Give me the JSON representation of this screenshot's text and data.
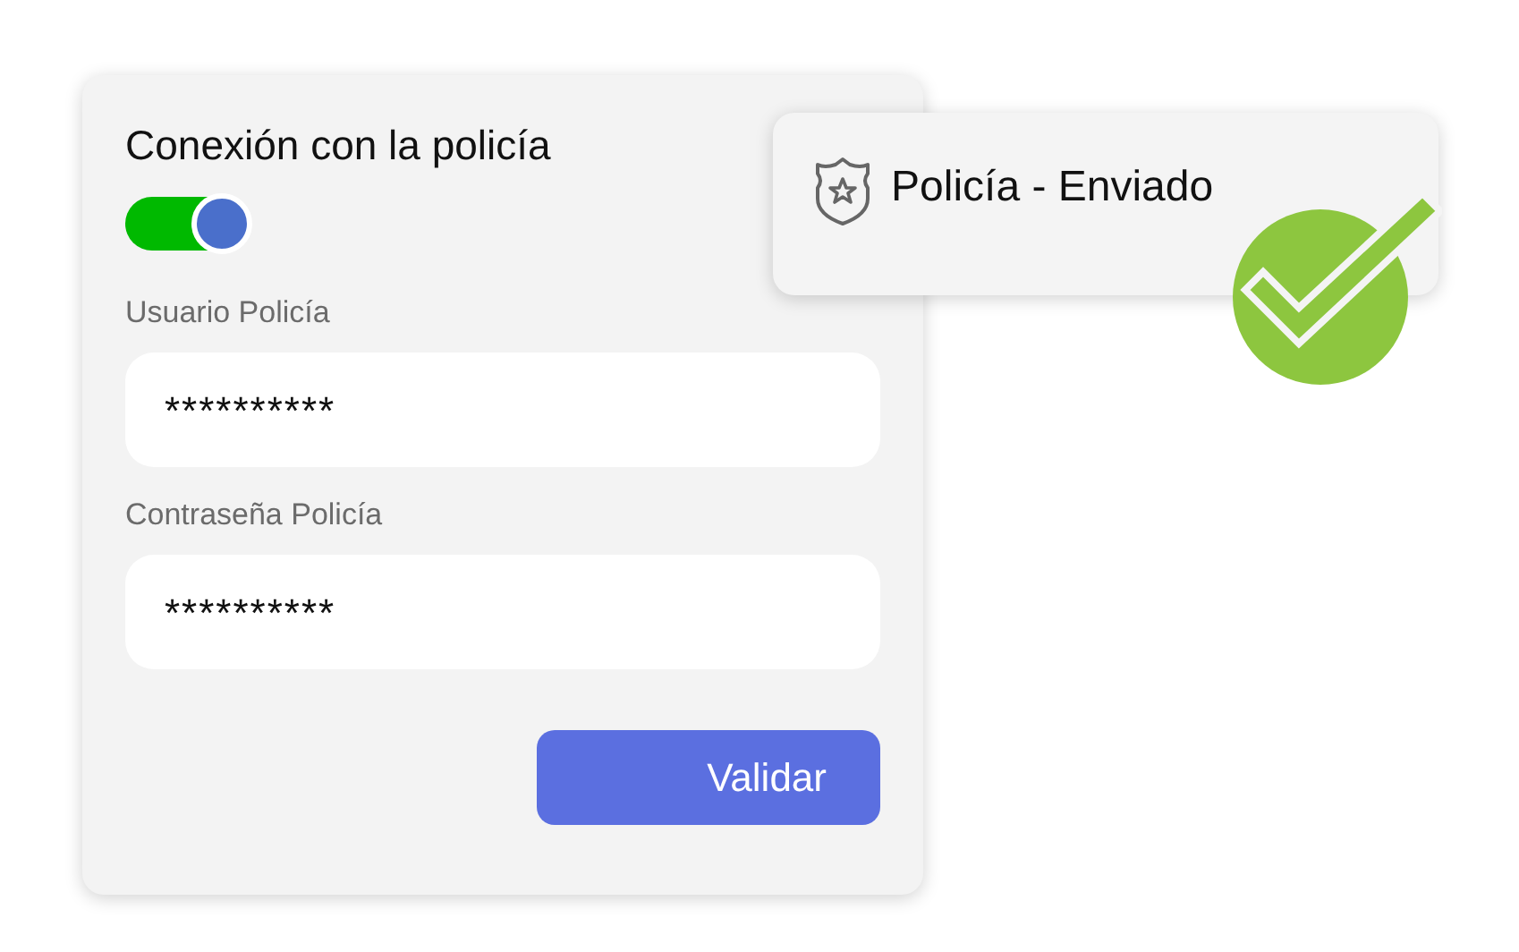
{
  "form": {
    "title": "Conexión con la policía",
    "toggle": {
      "on": true
    },
    "fields": [
      {
        "label": "Usuario Policía",
        "value": "**********"
      },
      {
        "label": "Contraseña Policía",
        "value": "**********"
      }
    ],
    "button": "Validar"
  },
  "notification": {
    "text": "Policía - Enviado",
    "sent": true
  }
}
